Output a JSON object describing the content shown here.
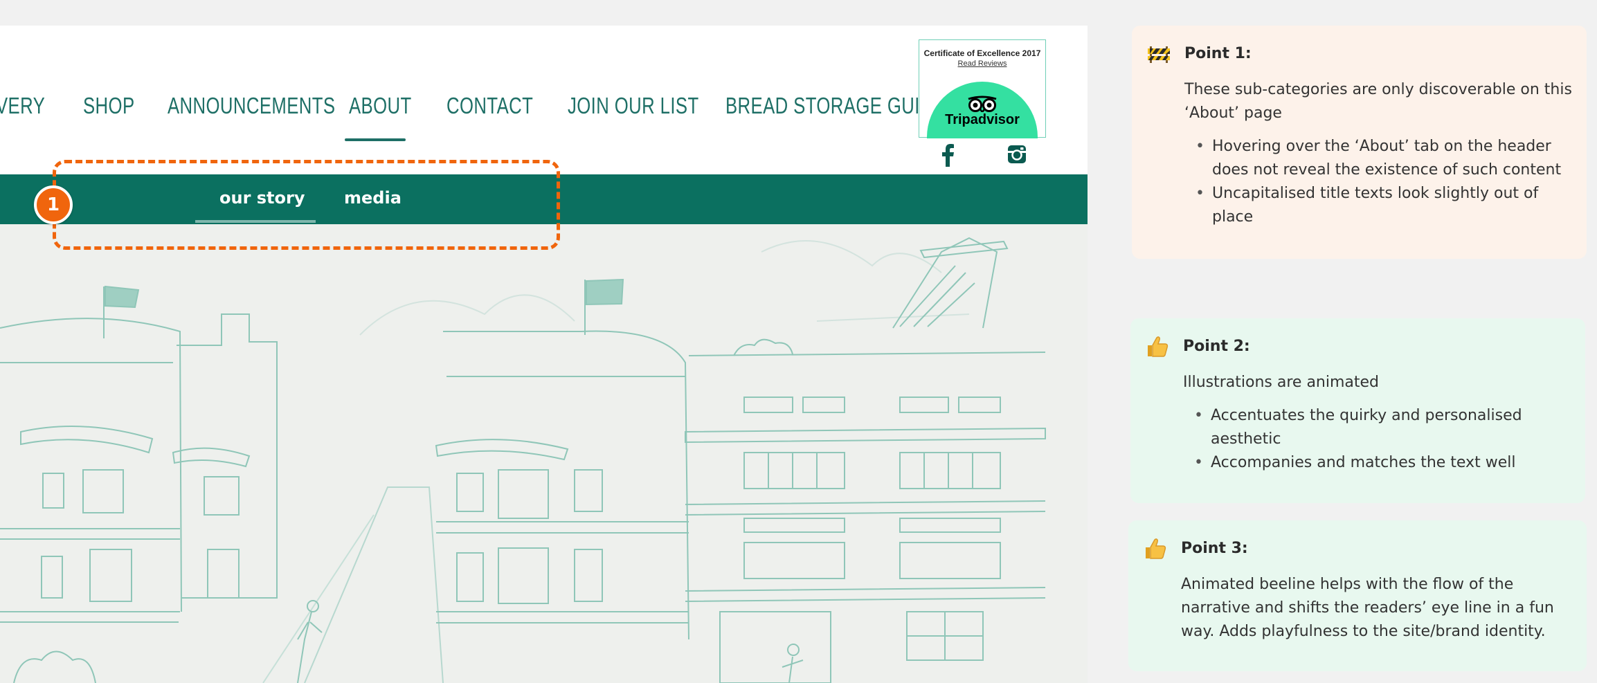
{
  "nav": {
    "items": [
      "VERY",
      "SHOP",
      "ANNOUNCEMENTS",
      "ABOUT",
      "CONTACT",
      "JOIN OUR LIST",
      "BREAD STORAGE GUIDE"
    ],
    "active": "ABOUT"
  },
  "tripadvisor": {
    "certificate": "Certificate of Excellence 2017",
    "read_reviews": "Read Reviews",
    "name": "Tripadvisor"
  },
  "social": {
    "facebook": "f"
  },
  "subnav": {
    "items": [
      "our story",
      "media"
    ],
    "active": "our story"
  },
  "callout": {
    "badge": "1"
  },
  "colors": {
    "brand_green": "#0b7060",
    "nav_text": "#1e6f66",
    "callout_orange": "#f0650d",
    "tripadvisor_green": "#34e0a1"
  },
  "notes": [
    {
      "icon": "construction-icon",
      "title": "Point 1:",
      "text": "These sub-categories are only discoverable on this ‘About’ page",
      "bullets": [
        "Hovering over the ‘About’ tab on the header does not reveal the existence of such content",
        "Uncapitalised title texts look slightly out of place"
      ]
    },
    {
      "icon": "thumbs-up-icon",
      "title": "Point 2:",
      "text": "Illustrations are animated",
      "bullets": [
        "Accentuates the quirky and personalised aesthetic",
        "Accompanies and matches the text well"
      ]
    },
    {
      "icon": "thumbs-up-icon",
      "title": "Point 3:",
      "text": "Animated beeline helps with the flow of the narrative and shifts the readers’ eye line in a fun way. Adds playfulness to the site/brand identity.",
      "bullets": []
    }
  ]
}
